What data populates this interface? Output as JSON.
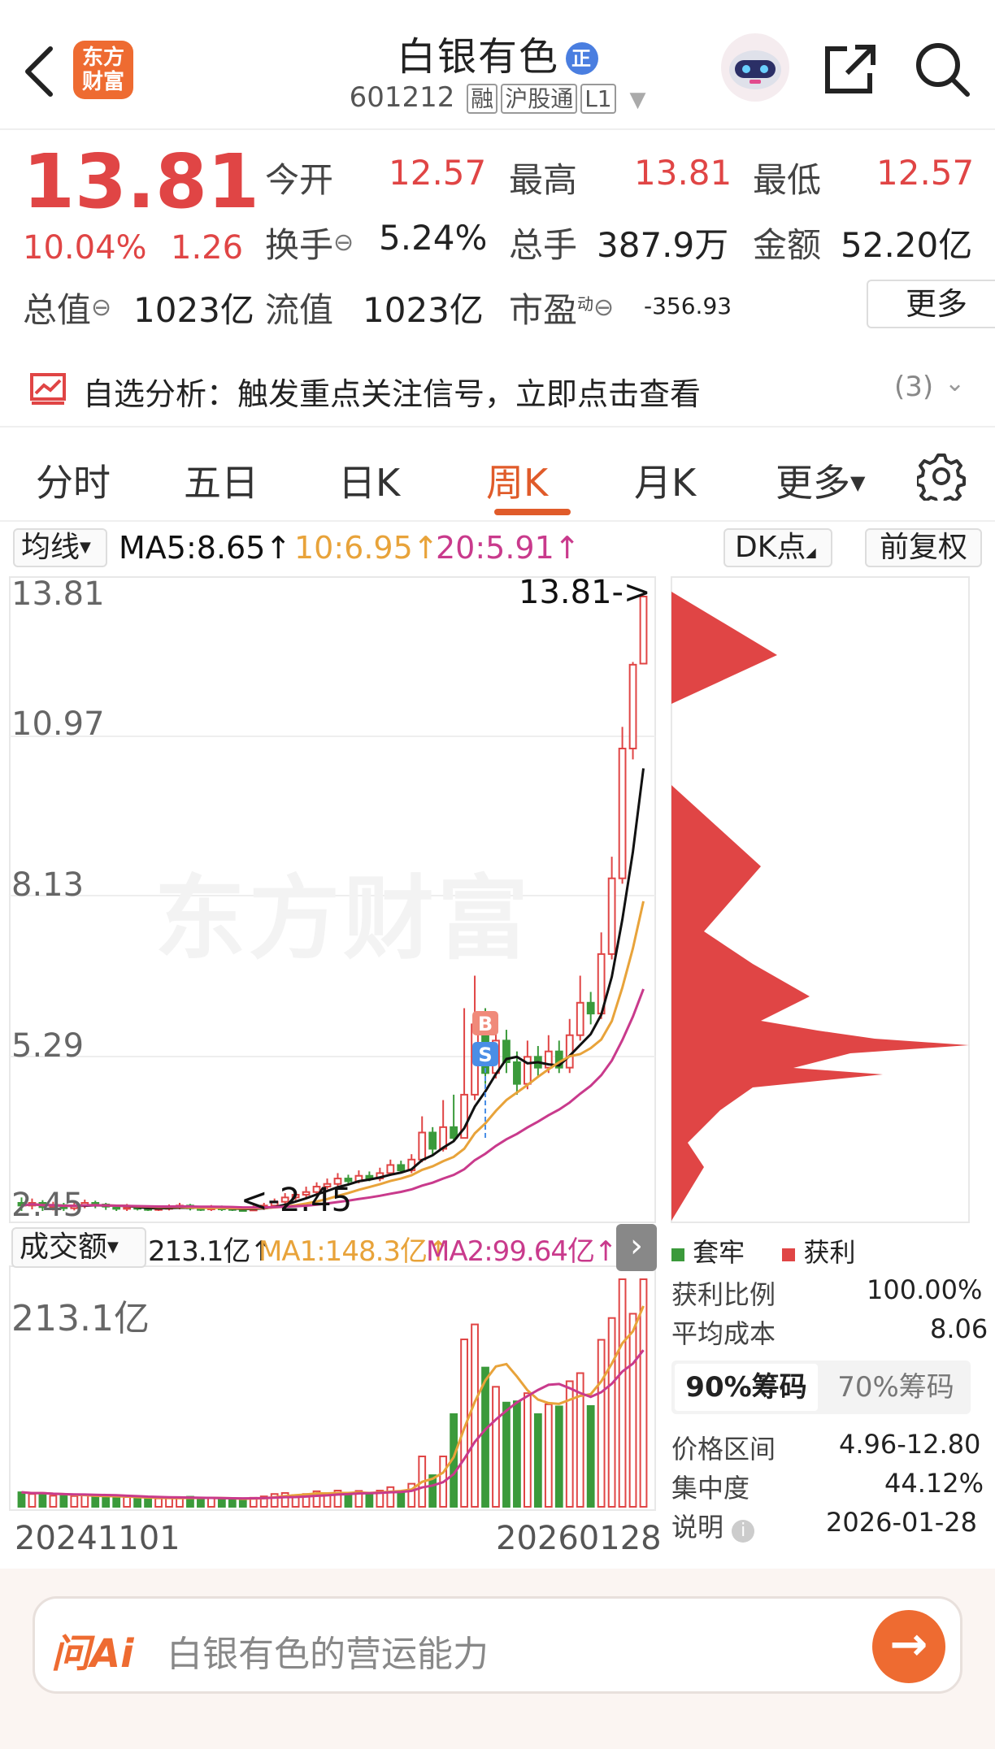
{
  "header": {
    "logo_text": "东方\n财富",
    "title": "白银有色",
    "badge": "正",
    "code": "601212",
    "tags": [
      "融",
      "沪股通",
      "L1"
    ],
    "icons": [
      "back-arrow-icon",
      "robot-avatar-icon",
      "share-icon",
      "search-icon"
    ]
  },
  "quote": {
    "price": "13.81",
    "change_pct": "10.04%",
    "change": "1.26",
    "open_label": "今开",
    "open": "12.57",
    "high_label": "最高",
    "high": "13.81",
    "low_label": "最低",
    "low": "12.57",
    "turnover_label": "换手",
    "turnover": "5.24%",
    "volume_label": "总手",
    "volume": "387.9万",
    "amount_label": "金额",
    "amount": "52.20亿",
    "mktcap_label": "总值",
    "mktcap": "1023亿",
    "float_label": "流值",
    "float": "1023亿",
    "pe_label": "市盈",
    "pe_sup": "动",
    "pe": "-356.93",
    "more": "更多"
  },
  "banner": {
    "text": "自选分析：触发重点关注信号，立即点击查看",
    "count": "(3)"
  },
  "tabs": [
    "分时",
    "五日",
    "日K",
    "周K",
    "月K",
    "更多"
  ],
  "active_tab": "周K",
  "ma": {
    "selector": "均线",
    "ma5": "MA5:8.65↑",
    "ma10": "10:6.95↑",
    "ma20": "20:5.91↑",
    "dk": "DK点",
    "fq": "前复权"
  },
  "price_axis": [
    "13.81",
    "10.97",
    "8.13",
    "5.29",
    "2.45"
  ],
  "annotations": {
    "high": "13.81->",
    "low": "<-2.45",
    "buy": "B",
    "sell": "S",
    "watermark": "东方财富"
  },
  "volume_bar": {
    "selector": "成交额",
    "value": "213.1亿↑",
    "ma1": "MA1:148.3亿↑",
    "ma2": "MA2:99.64亿↑",
    "axis_max": "213.1亿"
  },
  "dates": {
    "start": "20241101",
    "end": "20260128"
  },
  "chips": {
    "legend_trapped": "套牢",
    "legend_profit": "获利",
    "profit_ratio_label": "获利比例",
    "profit_ratio": "100.00%",
    "avg_cost_label": "平均成本",
    "avg_cost": "8.06",
    "tab90": "90%筹码",
    "tab70": "70%筹码",
    "range_label": "价格区间",
    "range": "4.96-12.80",
    "conc_label": "集中度",
    "conc": "44.12%",
    "note_label": "说明",
    "note": "2026-01-28"
  },
  "ask": {
    "brand": "问Ai",
    "placeholder": "白银有色的营运能力"
  },
  "colors": {
    "up": "#e04545",
    "down": "#3b9a3b",
    "ma5": "#111111",
    "ma10": "#e8a33a",
    "ma20": "#c93a8c",
    "accent": "#e05b2a"
  },
  "chart_data": {
    "type": "candlestick",
    "x": [
      "20241101",
      "20260128"
    ],
    "ylim": [
      2.45,
      13.81
    ],
    "candles": [
      [
        2.6,
        2.55,
        2.7,
        2.45
      ],
      [
        2.55,
        2.6,
        2.68,
        2.48
      ],
      [
        2.6,
        2.52,
        2.65,
        2.45
      ],
      [
        2.52,
        2.56,
        2.62,
        2.46
      ],
      [
        2.56,
        2.5,
        2.6,
        2.45
      ],
      [
        2.5,
        2.55,
        2.6,
        2.46
      ],
      [
        2.55,
        2.6,
        2.66,
        2.5
      ],
      [
        2.6,
        2.57,
        2.64,
        2.5
      ],
      [
        2.57,
        2.53,
        2.6,
        2.47
      ],
      [
        2.53,
        2.49,
        2.57,
        2.45
      ],
      [
        2.49,
        2.52,
        2.58,
        2.45
      ],
      [
        2.52,
        2.5,
        2.56,
        2.46
      ],
      [
        2.5,
        2.48,
        2.55,
        2.45
      ],
      [
        2.48,
        2.5,
        2.55,
        2.45
      ],
      [
        2.5,
        2.52,
        2.57,
        2.46
      ],
      [
        2.52,
        2.55,
        2.6,
        2.48
      ],
      [
        2.55,
        2.5,
        2.58,
        2.46
      ],
      [
        2.5,
        2.49,
        2.54,
        2.45
      ],
      [
        2.49,
        2.51,
        2.56,
        2.45
      ],
      [
        2.51,
        2.5,
        2.55,
        2.45
      ],
      [
        2.5,
        2.48,
        2.54,
        2.45
      ],
      [
        2.48,
        2.46,
        2.52,
        2.45
      ],
      [
        2.46,
        2.5,
        2.55,
        2.45
      ],
      [
        2.5,
        2.55,
        2.6,
        2.47
      ],
      [
        2.55,
        2.62,
        2.68,
        2.5
      ],
      [
        2.62,
        2.7,
        2.78,
        2.58
      ],
      [
        2.7,
        2.75,
        2.82,
        2.65
      ],
      [
        2.75,
        2.8,
        2.9,
        2.7
      ],
      [
        2.8,
        2.9,
        2.98,
        2.75
      ],
      [
        2.9,
        2.95,
        3.05,
        2.85
      ],
      [
        2.95,
        3.05,
        3.15,
        2.9
      ],
      [
        3.05,
        3.0,
        3.12,
        2.95
      ],
      [
        3.0,
        3.1,
        3.2,
        2.96
      ],
      [
        3.1,
        3.05,
        3.18,
        3.0
      ],
      [
        3.05,
        3.15,
        3.25,
        3.0
      ],
      [
        3.15,
        3.3,
        3.4,
        3.1
      ],
      [
        3.3,
        3.2,
        3.38,
        3.15
      ],
      [
        3.2,
        3.4,
        3.5,
        3.15
      ],
      [
        3.4,
        3.9,
        4.2,
        3.35
      ],
      [
        3.9,
        3.6,
        4.0,
        3.5
      ],
      [
        3.6,
        4.0,
        4.5,
        3.55
      ],
      [
        4.0,
        3.8,
        4.6,
        3.75
      ],
      [
        3.8,
        4.6,
        6.2,
        3.8
      ],
      [
        4.6,
        5.9,
        6.8,
        4.5
      ],
      [
        5.9,
        5.0,
        6.2,
        4.8
      ],
      [
        5.0,
        5.6,
        6.0,
        4.9
      ],
      [
        5.6,
        5.2,
        5.8,
        5.0
      ],
      [
        5.2,
        4.8,
        5.4,
        4.6
      ],
      [
        4.8,
        5.3,
        5.6,
        4.7
      ],
      [
        5.3,
        5.1,
        5.5,
        4.95
      ],
      [
        5.1,
        5.4,
        5.7,
        5.0
      ],
      [
        5.4,
        5.1,
        5.6,
        5.0
      ],
      [
        5.1,
        5.7,
        6.0,
        5.0
      ],
      [
        5.7,
        6.3,
        6.8,
        5.6
      ],
      [
        6.3,
        6.1,
        6.5,
        5.9
      ],
      [
        6.1,
        7.2,
        7.6,
        6.0
      ],
      [
        7.2,
        8.6,
        9.0,
        7.1
      ],
      [
        8.6,
        11.0,
        11.4,
        8.5
      ],
      [
        11.0,
        12.55,
        12.6,
        10.8
      ],
      [
        12.57,
        13.81,
        13.81,
        12.57
      ]
    ],
    "ma5_end": 8.65,
    "ma10_end": 6.95,
    "ma20_end": 5.91,
    "amount_max": 213.1
  }
}
